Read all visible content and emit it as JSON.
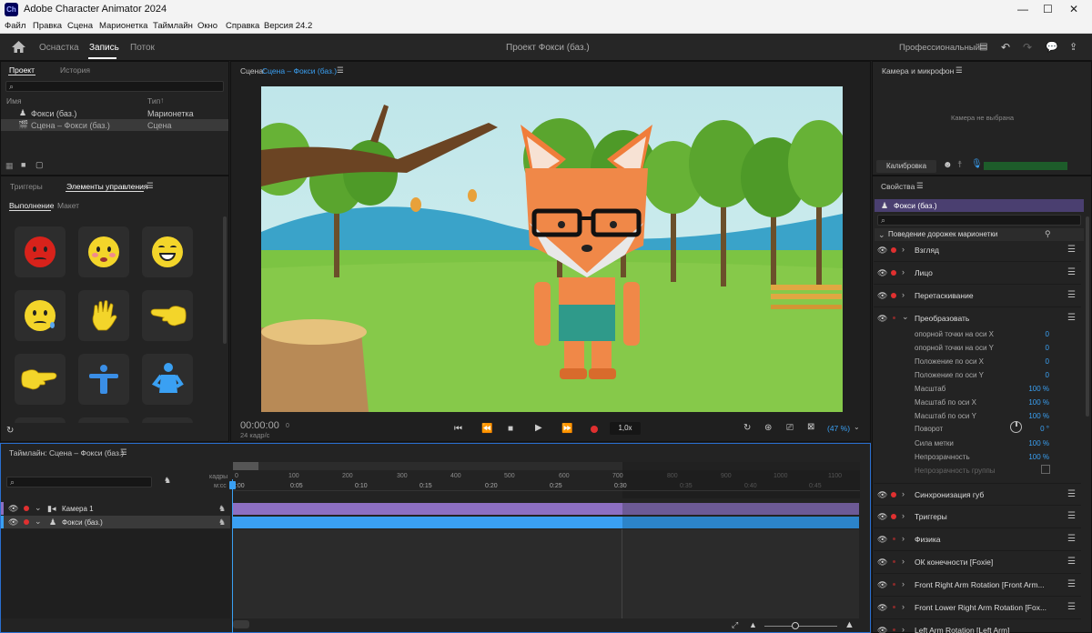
{
  "window": {
    "title": "Adobe Character Animator 2024",
    "logo": "Ch"
  },
  "menu": [
    "Файл",
    "Правка",
    "Сцена",
    "Марионетка",
    "Таймлайн",
    "Окно",
    "Справка",
    "Версия 24.2"
  ],
  "top_tabs": [
    "Оснастка",
    "Запись",
    "Поток"
  ],
  "project_title": "Проект Фокси (баз.)",
  "workspace": "Профессиональный",
  "project_panel": {
    "tabs": [
      "Проект",
      "История"
    ],
    "col_name": "Имя",
    "col_type": "Тип",
    "items": [
      {
        "name": "Фокси (баз.)",
        "type": "Марионетка"
      },
      {
        "name": "Сцена – Фокси (баз.)",
        "type": "Сцена"
      }
    ]
  },
  "controls_panel": {
    "tabs": [
      "Триггеры",
      "Элементы управления"
    ],
    "subtabs": [
      "Выполнение",
      "Макет"
    ]
  },
  "scene": {
    "label": "Сцена:",
    "name": "Сцена – Фокси (баз.)",
    "timecode": "00:00:00",
    "frame": "0",
    "fps": "24 кадр/с",
    "speed": "1,0x",
    "zoom": "(47 %)"
  },
  "camera_panel": {
    "title": "Камера и микрофон",
    "no_camera": "Камера не выбрана",
    "calibrate": "Калибровка"
  },
  "properties": {
    "title": "Свойства",
    "puppet": "Фокси (баз.)",
    "section": "Поведение дорожек марионетки",
    "behaviors_top": [
      "Взгляд",
      "Лицо",
      "Перетаскивание",
      "Преобразовать"
    ],
    "transform_params": [
      {
        "label": "опорной точки на оси X",
        "value": "0"
      },
      {
        "label": "опорной точки на оси Y",
        "value": "0"
      },
      {
        "label": "Положение по оси X",
        "value": "0"
      },
      {
        "label": "Положение по оси Y",
        "value": "0"
      },
      {
        "label": "Масштаб",
        "value": "100 %"
      },
      {
        "label": "Масштаб по оси X",
        "value": "100 %"
      },
      {
        "label": "Масштаб по оси Y",
        "value": "100 %"
      },
      {
        "label": "Поворот",
        "value": "0 °"
      },
      {
        "label": "Сила метки",
        "value": "100 %"
      },
      {
        "label": "Непрозрачность",
        "value": "100 %"
      },
      {
        "label": "Непрозрачность группы",
        "value": ""
      }
    ],
    "behaviors_bottom": [
      "Синхронизация губ",
      "Триггеры",
      "Физика",
      "ОК конечности [Foxie]",
      "Front Right Arm Rotation [Front Arm...",
      "Front Lower Right Arm Rotation [Fox...",
      "Left Arm Rotation [Left Arm]"
    ]
  },
  "timeline": {
    "title": "Таймлайн: Сцена – Фокси (баз.)",
    "frames_label": "кадры",
    "time_label": "м:сс",
    "frame_ticks": [
      "0",
      "100",
      "200",
      "300",
      "400",
      "500",
      "600",
      "700",
      "800",
      "900",
      "1000",
      "1100"
    ],
    "time_ticks": [
      "0:00",
      "0:05",
      "0:10",
      "0:15",
      "0:20",
      "0:25",
      "0:30",
      "0:35",
      "0:40",
      "0:45"
    ],
    "tracks": [
      "Камера 1",
      "Фокси (баз.)"
    ]
  }
}
